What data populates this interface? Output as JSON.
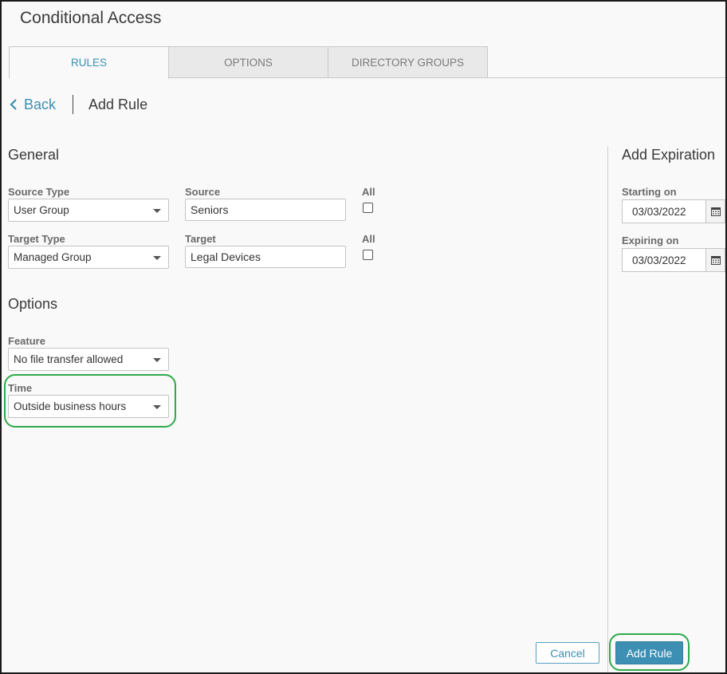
{
  "app": {
    "title": "Conditional Access"
  },
  "tabs": [
    {
      "label": "RULES",
      "active": true
    },
    {
      "label": "OPTIONS",
      "active": false
    },
    {
      "label": "DIRECTORY GROUPS",
      "active": false
    }
  ],
  "subheader": {
    "back_label": "Back",
    "title": "Add Rule"
  },
  "general": {
    "title": "General",
    "source_type": {
      "label": "Source Type",
      "value": "User Group"
    },
    "source": {
      "label": "Source",
      "value": "Seniors"
    },
    "source_all": {
      "label": "All",
      "checked": false
    },
    "target_type": {
      "label": "Target Type",
      "value": "Managed Group"
    },
    "target": {
      "label": "Target",
      "value": "Legal Devices"
    },
    "target_all": {
      "label": "All",
      "checked": false
    }
  },
  "options": {
    "title": "Options",
    "feature": {
      "label": "Feature",
      "value": "No file transfer allowed"
    },
    "time": {
      "label": "Time",
      "value": "Outside business hours"
    }
  },
  "expiration": {
    "title": "Add Expiration",
    "starting": {
      "label": "Starting on",
      "value": "03/03/2022"
    },
    "expiring": {
      "label": "Expiring on",
      "value": "03/03/2022"
    }
  },
  "footer": {
    "cancel_label": "Cancel",
    "add_label": "Add Rule"
  },
  "colors": {
    "accent": "#3d8fb3",
    "highlight": "#2eaa4a",
    "background": "#f9f9f9"
  },
  "icons": {
    "back": "chevron-left-icon",
    "calendar": "calendar-icon",
    "dropdown": "caret-down-icon"
  }
}
